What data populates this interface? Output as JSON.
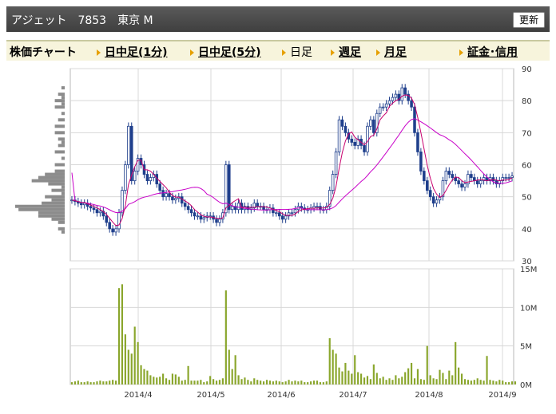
{
  "header": {
    "title": "アジェット　7853　東京 M",
    "refresh_label": "更新"
  },
  "nav": {
    "label": "株価チャート",
    "items": [
      {
        "label": "日中足(1分)",
        "type": "link"
      },
      {
        "label": "日中足(5分)",
        "type": "link"
      },
      {
        "label": "日足",
        "type": "plain"
      },
      {
        "label": "週足",
        "type": "link"
      },
      {
        "label": "月足",
        "type": "link"
      },
      {
        "label": "証金･信用",
        "type": "link"
      }
    ]
  },
  "colors": {
    "up": "#ffffff",
    "down": "#1f3f8c",
    "wick": "#1f3f8c",
    "ma_short": "#c8006e",
    "ma_long": "#c800c8",
    "volume": "#8aa62c",
    "profile": "#8c8c8c"
  },
  "chart_data": [
    {
      "type": "candlestick",
      "y_tick_labels": [
        "90",
        "80",
        "70",
        "60",
        "50",
        "40",
        "30"
      ],
      "ylim": [
        30,
        90
      ],
      "x_tick_labels": [
        "2014/4",
        "2014/5",
        "2014/6",
        "2014/7",
        "2014/8",
        "2014/9"
      ],
      "grid": true,
      "series": [
        {
          "kind": "ohlc",
          "close": [
            49,
            48.5,
            48,
            47.5,
            48,
            47,
            46.5,
            46,
            45,
            45.5,
            44,
            42,
            40,
            39,
            40,
            45,
            52,
            60,
            72,
            55,
            58,
            62,
            60,
            57,
            55,
            56,
            57,
            54,
            52,
            50,
            51,
            50,
            49,
            49.5,
            50,
            48,
            47,
            46,
            45,
            44,
            44,
            43,
            43.5,
            44,
            44,
            43,
            42,
            43,
            45,
            60,
            46,
            47,
            46,
            48,
            46,
            47,
            46,
            46.5,
            48,
            47,
            47,
            46,
            46,
            46.5,
            45,
            45,
            44,
            43,
            44,
            45,
            45,
            46,
            47,
            46.5,
            46,
            46,
            46.5,
            47,
            47,
            46,
            46,
            47,
            52,
            57,
            64,
            74,
            72,
            70,
            68,
            67,
            66,
            68,
            66,
            64,
            72,
            74,
            70,
            76,
            78,
            78,
            79,
            80,
            81,
            82,
            80,
            84,
            82,
            80,
            78,
            70,
            64,
            58,
            55,
            52,
            50,
            48,
            49,
            50,
            55,
            58,
            57,
            56,
            55,
            54,
            53,
            54,
            57,
            56,
            55,
            54,
            55,
            56,
            55,
            56,
            55,
            54,
            55,
            56,
            56,
            56,
            56.5
          ]
        },
        {
          "kind": "ma_short"
        },
        {
          "kind": "ma_long"
        },
        {
          "kind": "volume_profile"
        }
      ]
    },
    {
      "type": "bar",
      "y_tick_labels": [
        "15M",
        "10M",
        "5M",
        "0M"
      ],
      "ylim": [
        0,
        15000000
      ],
      "x_tick_labels": [
        "2014/4",
        "2014/5",
        "2014/6",
        "2014/7",
        "2014/8",
        "2014/9"
      ],
      "series": [
        {
          "name": "volume",
          "values": [
            0.3,
            0.4,
            0.5,
            0.3,
            0.3,
            0.4,
            0.3,
            0.3,
            0.4,
            0.5,
            0.4,
            0.4,
            0.5,
            0.6,
            0.5,
            12.5,
            13,
            6.5,
            4.5,
            4,
            7.5,
            5.5,
            2.5,
            2,
            1.8,
            1.2,
            1.0,
            0.9,
            1.0,
            1.4,
            0.8,
            0.6,
            1.4,
            1.3,
            1.0,
            0.5,
            0.6,
            2.4,
            0.5,
            0.5,
            0.5,
            0.6,
            0.3,
            0.4,
            1.1,
            0.7,
            0.5,
            0.6,
            0.8,
            12.2,
            4.5,
            2.0,
            3.8,
            1.2,
            0.7,
            0.9,
            0.6,
            0.4,
            0.8,
            0.6,
            0.5,
            0.4,
            0.6,
            0.5,
            0.4,
            0.5,
            0.4,
            0.3,
            0.4,
            0.6,
            0.4,
            0.5,
            0.4,
            0.5,
            0.3,
            0.3,
            0.4,
            0.5,
            0.5,
            0.3,
            0.3,
            0.4,
            6.0,
            4.5,
            4.0,
            2.2,
            1.7,
            2.8,
            1.8,
            1.4,
            3.8,
            1.6,
            1.4,
            0.9,
            1.1,
            0.7,
            2.6,
            1.5,
            0.8,
            1.0,
            0.6,
            0.8,
            0.6,
            1.2,
            0.8,
            1.0,
            1.6,
            2.1,
            2.8,
            0.8,
            2.0,
            0.7,
            0.6,
            5.0,
            1.2,
            0.8,
            0.7,
            1.9,
            1.5,
            0.7,
            1.8,
            1.2,
            5.5,
            2.2,
            1.4,
            0.7,
            0.6,
            0.5,
            0.6,
            0.8,
            0.6,
            0.5,
            3.7,
            0.6,
            0.5,
            0.4,
            0.6,
            0.5,
            0.3,
            0.3,
            0.4,
            0.4
          ]
        }
      ]
    }
  ]
}
